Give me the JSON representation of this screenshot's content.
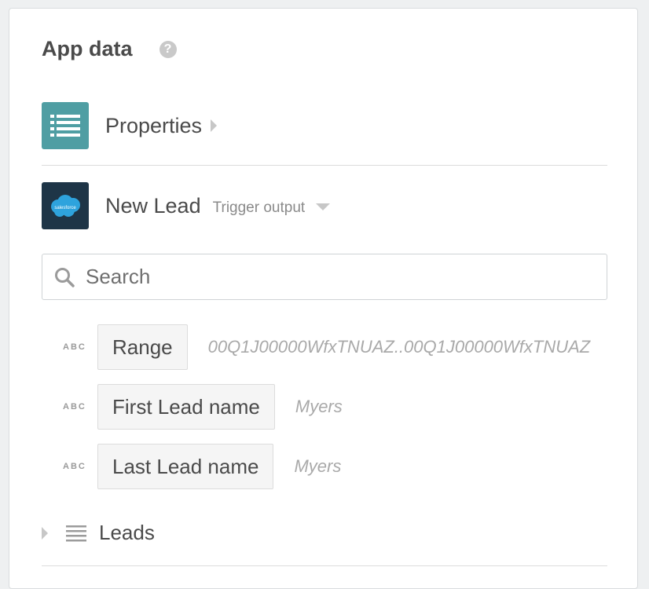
{
  "panel": {
    "title": "App data",
    "help_icon": "question-circle-icon"
  },
  "properties": {
    "label": "Properties",
    "icon": "list-icon",
    "icon_bg": "#4f9ea3"
  },
  "trigger": {
    "label": "New Lead",
    "sublabel": "Trigger output",
    "icon": "salesforce-logo",
    "icon_text": "salesforce",
    "icon_bg": "#1e3547",
    "cloud_color": "#2ea3dd"
  },
  "search": {
    "placeholder": "Search",
    "value": ""
  },
  "fields": [
    {
      "type": "ABC",
      "label": "Range",
      "value": "00Q1J00000WfxTNUAZ..00Q1J00000WfxTNUAZ"
    },
    {
      "type": "ABC",
      "label": "First Lead name",
      "value": "Myers"
    },
    {
      "type": "ABC",
      "label": "Last Lead name",
      "value": "Myers"
    }
  ],
  "leads": {
    "label": "Leads",
    "icon": "list-lines-icon"
  }
}
